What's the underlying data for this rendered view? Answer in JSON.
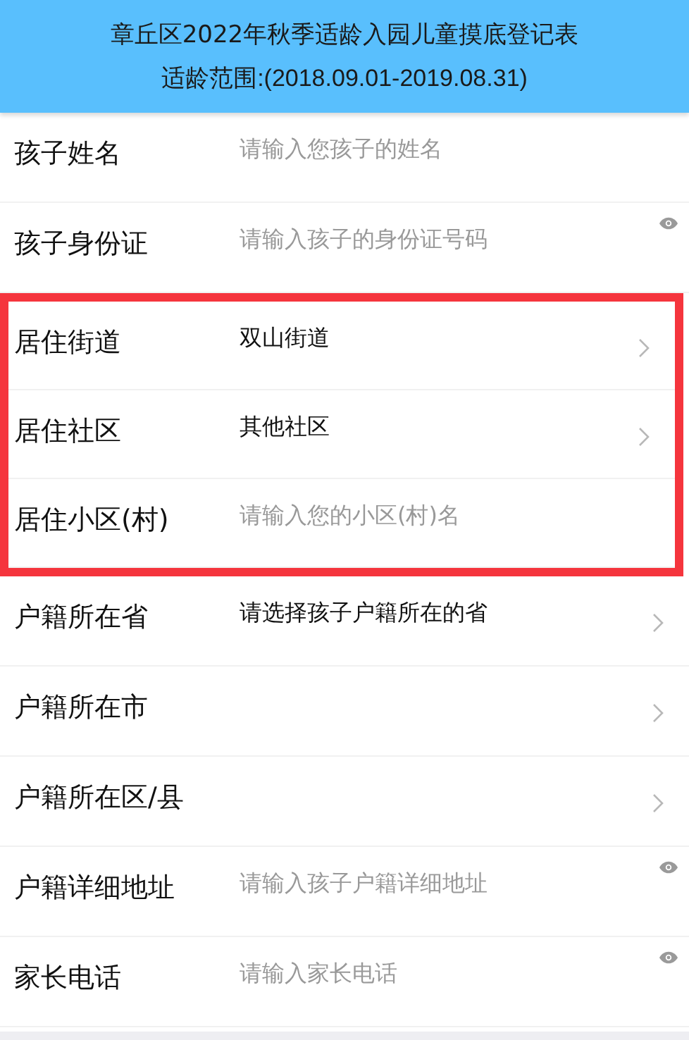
{
  "header": {
    "title": "章丘区2022年秋季适龄入园儿童摸底登记表",
    "subtitle": "适龄范围:(2018.09.01-2019.08.31)"
  },
  "fields": [
    {
      "label": "孩子姓名",
      "kind": "input",
      "placeholder": "请输入您孩子的姓名",
      "eye": false,
      "highlighted": false
    },
    {
      "label": "孩子身份证",
      "kind": "input",
      "placeholder": "请输入孩子的身份证号码",
      "eye": true,
      "highlighted": false
    },
    {
      "label": "居住街道",
      "kind": "select",
      "value": "双山街道",
      "highlighted": true
    },
    {
      "label": "居住社区",
      "kind": "select",
      "value": "其他社区",
      "highlighted": true
    },
    {
      "label": "居住小区(村)",
      "kind": "input",
      "placeholder": "请输入您的小区(村)名",
      "eye": false,
      "highlighted": true
    },
    {
      "label": "户籍所在省",
      "kind": "select",
      "value": "请选择孩子户籍所在的省",
      "highlighted": false
    },
    {
      "label": "户籍所在市",
      "kind": "select",
      "highlighted": false
    },
    {
      "label": "户籍所在区/县",
      "kind": "select",
      "highlighted": false
    },
    {
      "label": "户籍详细地址",
      "kind": "input",
      "placeholder": "请输入孩子户籍详细地址",
      "eye": true,
      "highlighted": false
    },
    {
      "label": "家长电话",
      "kind": "input",
      "placeholder": "请输入家长电话",
      "eye": true,
      "highlighted": false
    }
  ]
}
